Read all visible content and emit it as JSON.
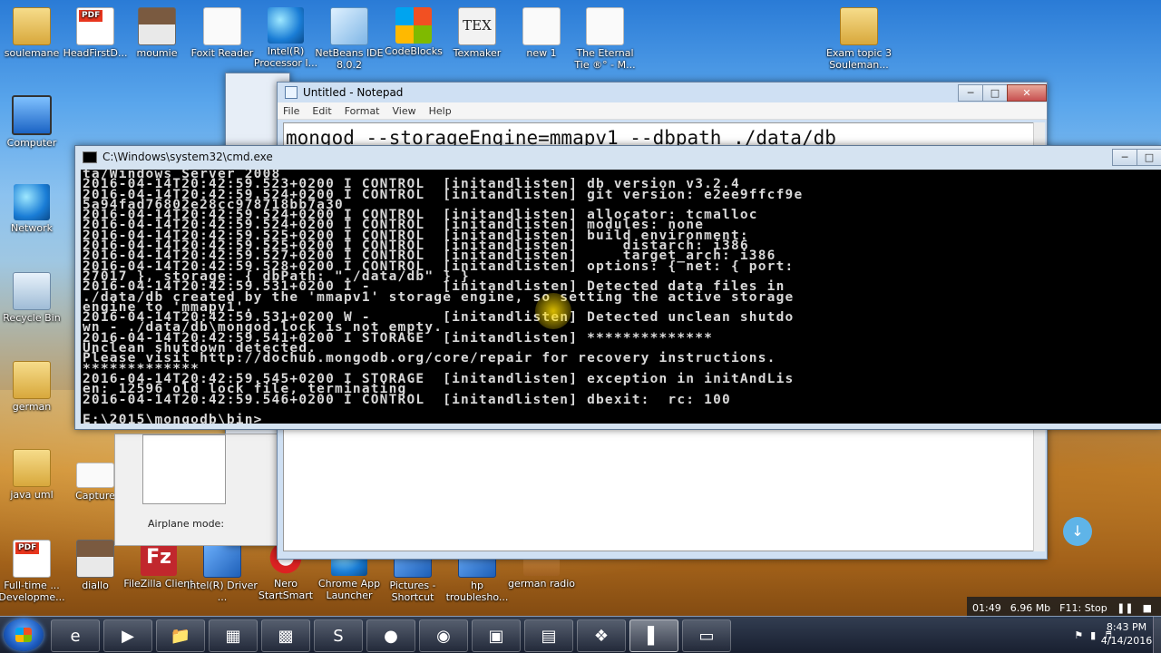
{
  "desktop": {
    "top_icons": [
      {
        "label": "soulemane",
        "icon": "folder-icon"
      },
      {
        "label": "HeadFirstD...",
        "icon": "pdf-icon"
      },
      {
        "label": "moumie",
        "icon": "person-photo-icon"
      },
      {
        "label": "Foxit Reader",
        "icon": "foxit-icon"
      },
      {
        "label": "Intel(R) Processor I...",
        "icon": "intel-icon"
      },
      {
        "label": "NetBeans IDE 8.0.2",
        "icon": "netbeans-cube-icon"
      },
      {
        "label": "CodeBlocks",
        "icon": "codeblocks-icon"
      },
      {
        "label": "Texmaker",
        "icon": "tex-icon"
      },
      {
        "label": "new 1",
        "icon": "document-icon"
      },
      {
        "label": "The Eternal Tie ®° - M...",
        "icon": "audio-file-icon"
      },
      {
        "label": "Exam topic 3 Souleman...",
        "icon": "folder-icon"
      }
    ],
    "left_icons": [
      {
        "label": "Computer",
        "icon": "computer-icon"
      },
      {
        "label": "Network",
        "icon": "network-icon"
      },
      {
        "label": "Recycle Bin",
        "icon": "recycle-bin-icon"
      },
      {
        "label": "german",
        "icon": "folder-icon"
      },
      {
        "label": "java uml",
        "icon": "folder-icon"
      }
    ],
    "bottom_icons": [
      {
        "label": "Full-time ... Developme...",
        "icon": "pdf-icon"
      },
      {
        "label": "diallo",
        "icon": "person-photo-icon"
      },
      {
        "label": "FileZilla Client",
        "icon": "filezilla-icon"
      },
      {
        "label": "Intel(R) Driver ...",
        "icon": "intel-icon"
      },
      {
        "label": "Nero StartSmart",
        "icon": "nero-icon"
      },
      {
        "label": "Chrome App Launcher",
        "icon": "chrome-icon"
      },
      {
        "label": "Pictures - Shortcut",
        "icon": "pictures-icon"
      },
      {
        "label": "hp troublesho...",
        "icon": "hp-icon"
      },
      {
        "label": "german radio",
        "icon": "radio-icon"
      }
    ],
    "partial_labels": {
      "capture": "Capture",
      "airplane": "Airplane mode:"
    }
  },
  "notepad": {
    "title": "Untitled - Notepad",
    "menu": [
      "File",
      "Edit",
      "Format",
      "View",
      "Help"
    ],
    "content": "mongod --storageEngine=mmapv1 --dbpath ./data/db"
  },
  "cmd": {
    "title": "C:\\Windows\\system32\\cmd.exe",
    "lines": [
      "ta/Windows Server 2008",
      "2016-04-14T20:42:59.523+0200 I CONTROL  [initandlisten] db version v3.2.4",
      "2016-04-14T20:42:59.524+0200 I CONTROL  [initandlisten] git version: e2ee9ffcf9e",
      "5a94fad76802e28cc978718bb7a30",
      "2016-04-14T20:42:59.524+0200 I CONTROL  [initandlisten] allocator: tcmalloc",
      "2016-04-14T20:42:59.524+0200 I CONTROL  [initandlisten] modules: none",
      "2016-04-14T20:42:59.525+0200 I CONTROL  [initandlisten] build environment:",
      "2016-04-14T20:42:59.525+0200 I CONTROL  [initandlisten]     distarch: i386",
      "2016-04-14T20:42:59.527+0200 I CONTROL  [initandlisten]     target_arch: i386",
      "2016-04-14T20:42:59.528+0200 I CONTROL  [initandlisten] options: { net: { port:",
      "27017 }, storage: { dbPath: \"./data/db\" } }",
      "2016-04-14T20:42:59.531+0200 I -        [initandlisten] Detected data files in",
      "./data/db created by the 'mmapv1' storage engine, so setting the active storage",
      "engine to 'mmapv1'.",
      "2016-04-14T20:42:59.531+0200 W -        [initandlisten] Detected unclean shutdo",
      "wn - ./data/db\\mongod.lock is not empty.",
      "2016-04-14T20:42:59.541+0200 I STORAGE  [initandlisten] **************",
      "Unclean shutdown detected.",
      "Please visit http://dochub.mongodb.org/core/repair for recovery instructions.",
      "*************",
      "2016-04-14T20:42:59.545+0200 I STORAGE  [initandlisten] exception in initAndLis",
      "en: 12596 old lock file, terminating",
      "2016-04-14T20:42:59.546+0200 I CONTROL  [initandlisten] dbexit:  rc: 100",
      "",
      "E:\\2015\\mongodb\\bin>"
    ]
  },
  "recorder": {
    "time": "01:49",
    "size": "6.96 Mb",
    "stop_label": "F11: Stop"
  },
  "taskbar": {
    "items": [
      "Internet Explorer",
      "Media Player",
      "File Explorer",
      "App Grid",
      "Terminal",
      "Skype",
      "Firefox",
      "Wi-Fi",
      "VirtualBox",
      "Charts",
      "XAMPP",
      "Command Prompt",
      "Notepad"
    ],
    "clock_time": "8:43 PM",
    "clock_date": "4/14/2016"
  },
  "colors": {
    "console_bg": "#000000",
    "console_fg": "#d8d8d8",
    "taskbar": "#1c2a40"
  }
}
